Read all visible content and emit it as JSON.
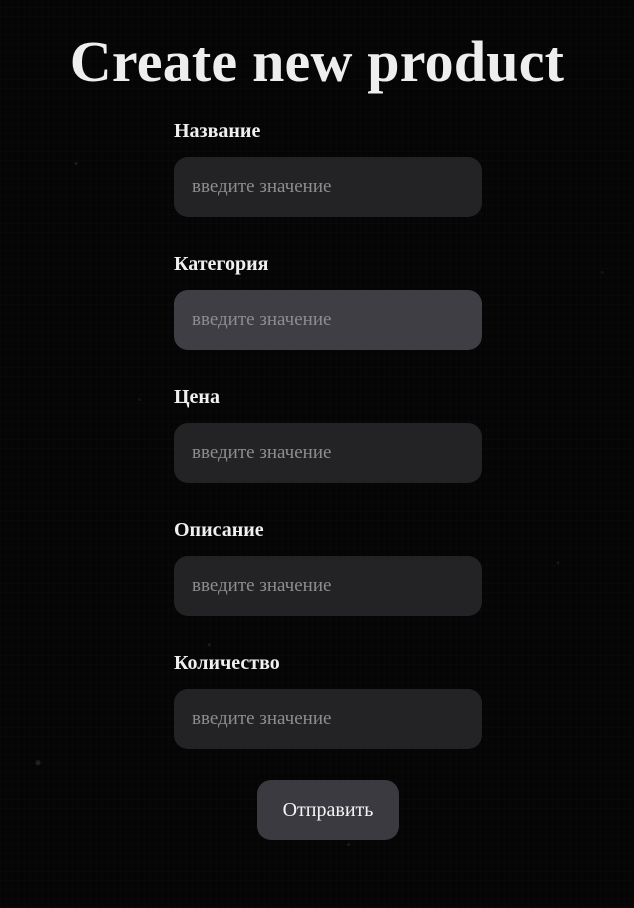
{
  "page": {
    "title": "Create new product"
  },
  "form": {
    "fields": [
      {
        "label": "Название",
        "value": "",
        "placeholder": "введите значение"
      },
      {
        "label": "Категория",
        "value": "",
        "placeholder": "введите значение"
      },
      {
        "label": "Цена",
        "value": "",
        "placeholder": "введите значение"
      },
      {
        "label": "Описание",
        "value": "",
        "placeholder": "введите значение"
      },
      {
        "label": "Количество",
        "value": "",
        "placeholder": "введите значение"
      }
    ],
    "submit_label": "Отправить"
  },
  "colors": {
    "background": "#050505",
    "input_background": "#232325",
    "input_focused_background": "#3f3e44",
    "button_background": "#3b3a40",
    "placeholder_text": "#8d8d91"
  }
}
